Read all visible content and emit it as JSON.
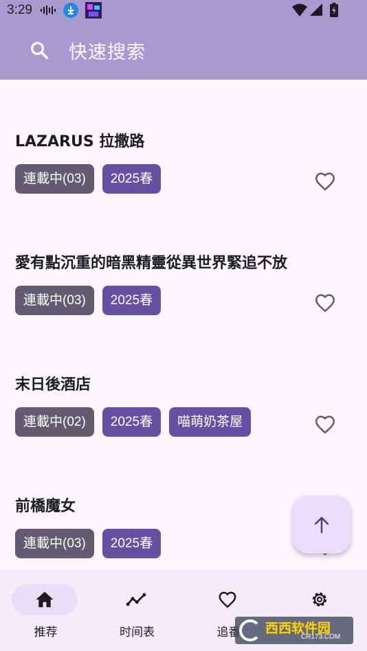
{
  "status_bar": {
    "time": "3:29"
  },
  "search": {
    "icon": "search-icon",
    "placeholder": "快速搜索"
  },
  "items": [
    {
      "title": "LAZARUS 拉撒路",
      "status": "連載中(03)",
      "season": "2025春",
      "group": ""
    },
    {
      "title": "愛有點沉重的暗黑精靈從異世界緊追不放",
      "status": "連載中(03)",
      "season": "2025春",
      "group": ""
    },
    {
      "title": "末日後酒店",
      "status": "連載中(02)",
      "season": "2025春",
      "group": "喵萌奶茶屋"
    },
    {
      "title": "前橋魔女",
      "status": "連載中(03)",
      "season": "2025春",
      "group": ""
    }
  ],
  "fab": {
    "icon": "arrow-up-icon"
  },
  "bottom_nav": [
    {
      "label": "推荐",
      "icon": "home-icon",
      "active": true
    },
    {
      "label": "时间表",
      "icon": "trend-icon",
      "active": false
    },
    {
      "label": "追番",
      "icon": "heart-icon",
      "active": false
    },
    {
      "label": "",
      "icon": "gear-icon",
      "active": false
    }
  ],
  "watermark": {
    "text": "西西软件园",
    "sub": "CR173.COM"
  },
  "colors": {
    "app_bar": "#a899cf",
    "background": "#fdf7ff",
    "tag_status": "#625b71",
    "tag_primary": "#6750a4",
    "fab": "#eaddff",
    "nav_bg": "#f3edf7",
    "nav_active_pill": "#e8def8"
  }
}
